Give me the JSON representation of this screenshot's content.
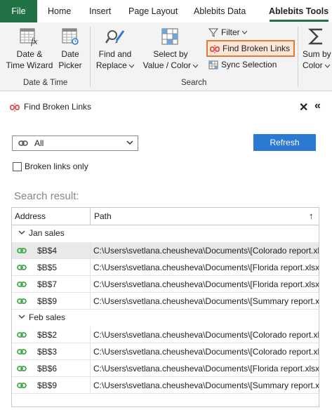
{
  "ribbon_tabs": {
    "file": "File",
    "home": "Home",
    "insert": "Insert",
    "page_layout": "Page Layout",
    "ablebits_data": "Ablebits Data",
    "ablebits_tools": "Ablebits Tools"
  },
  "ribbon": {
    "date_time_wizard": [
      "Date &",
      "Time Wizard"
    ],
    "date_picker": [
      "Date",
      "Picker"
    ],
    "group_date_time": "Date & Time",
    "find_replace": [
      "Find and",
      "Replace"
    ],
    "select_by_value": [
      "Select by",
      "Value / Color"
    ],
    "filter": "Filter",
    "find_broken_links": "Find Broken Links",
    "sync_selection": "Sync Selection",
    "group_search": "Search",
    "sum_by_color": [
      "Sum by",
      "Color"
    ]
  },
  "pane": {
    "title": "Find Broken Links",
    "scope_value": "All",
    "refresh_label": "Refresh",
    "broken_only_label": "Broken links only",
    "search_result_label": "Search result:",
    "col_address": "Address",
    "col_path": "Path",
    "sort_arrow": "↑"
  },
  "results": [
    {
      "group": "Jan sales",
      "rows": [
        {
          "address": "$B$4",
          "path": "C:\\Users\\svetlana.cheusheva\\Documents\\[Colorado report.xlsx]",
          "selected": true
        },
        {
          "address": "$B$5",
          "path": "C:\\Users\\svetlana.cheusheva\\Documents\\[Florida report.xlsx]",
          "selected": false
        },
        {
          "address": "$B$7",
          "path": "C:\\Users\\svetlana.cheusheva\\Documents\\[Florida report.xlsx]",
          "selected": false
        },
        {
          "address": "$B$9",
          "path": "C:\\Users\\svetlana.cheusheva\\Documents\\[Summary report.xlsx]",
          "selected": false
        }
      ]
    },
    {
      "group": "Feb sales",
      "rows": [
        {
          "address": "$B$2",
          "path": "C:\\Users\\svetlana.cheusheva\\Documents\\[Colorado report.xlsx]",
          "selected": false
        },
        {
          "address": "$B$3",
          "path": "C:\\Users\\svetlana.cheusheva\\Documents\\[Colorado report.xlsx]",
          "selected": false
        },
        {
          "address": "$B$6",
          "path": "C:\\Users\\svetlana.cheusheva\\Documents\\[Florida report.xlsx]",
          "selected": false
        },
        {
          "address": "$B$9",
          "path": "C:\\Users\\svetlana.cheusheva\\Documents\\[Summary report.xlsx]",
          "selected": false
        }
      ]
    }
  ],
  "colors": {
    "file_tab": "#217346",
    "refresh_button": "#2b79d3",
    "link_icon": "#3fae49",
    "highlight_border": "#e07a3a"
  },
  "icons": {
    "date_time_wizard": "calendar-fx-icon",
    "date_picker": "calendar-icon",
    "find_replace": "magnifier-pencil-icon",
    "select_by_value": "grid-select-icon",
    "filter": "funnel-icon",
    "find_broken_links": "broken-link-icon",
    "sync_selection": "sync-grid-icon",
    "sum_by_color": "sigma-icon",
    "link": "chain-link-icon"
  }
}
